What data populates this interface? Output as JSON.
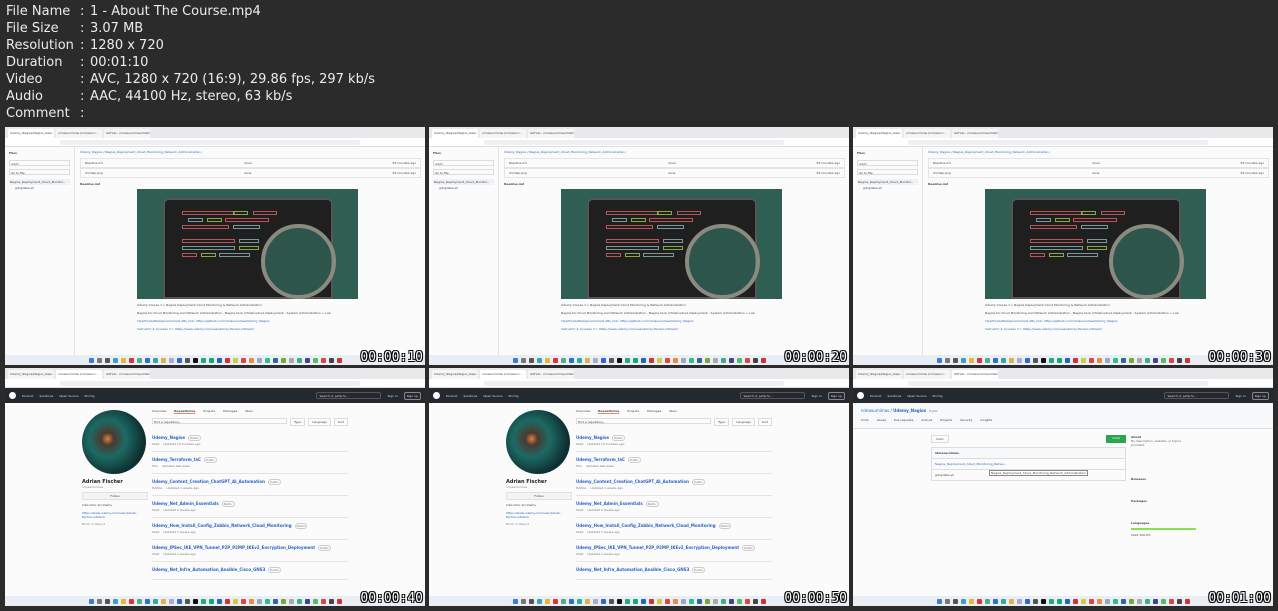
{
  "meta": [
    {
      "label": "File Name",
      "value": "1 - About The Course.mp4"
    },
    {
      "label": "File Size",
      "value": "3.07 MB"
    },
    {
      "label": "Resolution",
      "value": "1280 x 720"
    },
    {
      "label": "Duration",
      "value": "00:01:10"
    },
    {
      "label": "Video",
      "value": "AVC, 1280 x 720 (16:9), 29.86 fps, 297 kb/s"
    },
    {
      "label": "Audio",
      "value": "AAC, 44100 Hz, stereo, 63 kb/s"
    },
    {
      "label": "Comment",
      "value": ""
    }
  ],
  "tabs": [
    "Udemy_Nagios/Nagios_Depl...",
    "nimasurnimas (nimasurn...",
    "GitHub - nimasurnimas/Udemy..."
  ],
  "readme": {
    "files_label": "Files",
    "branch": "main",
    "go_to_file": "Go to file",
    "folder": "Nagios_Deployment_Cloud_Monitor...",
    "file": "gitupdate.sh",
    "breadcrumb": "Udemy_Nagios / Nagios_Deployment_Cloud_Monitoring_Network_Administration /",
    "rows": [
      {
        "name": "Readme.md",
        "msg": "done",
        "time": "55 minutes ago"
      },
      {
        "name": "Vmdisk.png",
        "msg": "done",
        "time": "55 minutes ago"
      }
    ],
    "section": "Readme.md",
    "line1": "Udemy Course => Nagios Deployment Cloud Monitoring & Network Administration",
    "line2": "Nagios for Cloud Monitoring and Network Administration - Nagios Core Infrastructure Deployment - System Administration + Lab",
    "line3": "Tips/Tricks/Notes/Commands URL Link: https://github.com/nimasurnimas/Udemy_Nagios",
    "line4": "Instructor & Courses => https://www.udemy.com/user/adrian-fischer-infotech/"
  },
  "nav": [
    "Product",
    "Solutions",
    "Open Source",
    "Pricing"
  ],
  "search": "Search or jump to...",
  "sign_in": "Sign in",
  "sign_up": "Sign up",
  "profile": {
    "name": "Adrian Fischer",
    "handle": "nimasurnimas",
    "follow": "Follow",
    "bio": "Instructor at Udemy",
    "link": "https://www.udemy.com/user/adrian-fischer-infotech",
    "block": "Block or Report",
    "tabs": [
      "Overview",
      "Repositories",
      "Projects",
      "Packages",
      "Stars"
    ],
    "find": "Find a repository...",
    "filters": [
      "Type",
      "Language",
      "Sort"
    ],
    "repos": [
      {
        "name": "Udemy_Nagios",
        "lang": "Shell",
        "updated": "Updated 14 minutes ago"
      },
      {
        "name": "Udemy_Terraform_IaC",
        "lang": "HCL",
        "updated": "Updated last week"
      },
      {
        "name": "Udemy_Content_Creation_ChatGPT_AI_Automation",
        "lang": "Python",
        "updated": "Updated 2 weeks ago"
      },
      {
        "name": "Udemy_Net_Admin_Essentials",
        "lang": "Shell",
        "updated": "Updated 2 weeks ago"
      },
      {
        "name": "Udemy_How_Install_Config_Zabbix_Network_Cloud_Monitoring",
        "lang": "Shell",
        "updated": "Updated 3 weeks ago"
      },
      {
        "name": "Udemy_IPSec_IKE_VPN_Tunnel_P2P_P2MP_IKEv2_Encryption_Deployment",
        "lang": "Shell",
        "updated": "Updated 3 weeks ago"
      },
      {
        "name": "Udemy_Net_Infra_Automation_Ansible_Cisco_GNS3",
        "lang": "",
        "updated": ""
      }
    ],
    "public": "Public"
  },
  "repo": {
    "owner": "nimasurnimas",
    "name": "Udemy_Nagios",
    "public": "Public",
    "tabs": [
      "Code",
      "Issues",
      "Pull requests",
      "Actions",
      "Projects",
      "Security",
      "Insights"
    ],
    "branch": "main",
    "code_btn": "Code",
    "commit_user": "nimasurnimas",
    "folder": "Nagios_Deployment_Cloud_Monitoring_Netwo...",
    "tooltip": "Nagios_Deployment_Cloud_Monitoring_Network_Administration",
    "file": "gitupdate.sh",
    "about": "About",
    "about_text": "No description, website, or topics provided.",
    "releases": "Releases",
    "packages": "Packages",
    "languages": "Languages",
    "lang": "Shell 100.0%"
  },
  "frames": [
    {
      "type": "readme",
      "time": "00:00:10"
    },
    {
      "type": "readme",
      "time": "00:00:20"
    },
    {
      "type": "readme",
      "time": "00:00:30"
    },
    {
      "type": "profile",
      "time": "00:00:40"
    },
    {
      "type": "profile",
      "time": "00:00:50"
    },
    {
      "type": "repo",
      "time": "00:01:00"
    }
  ]
}
